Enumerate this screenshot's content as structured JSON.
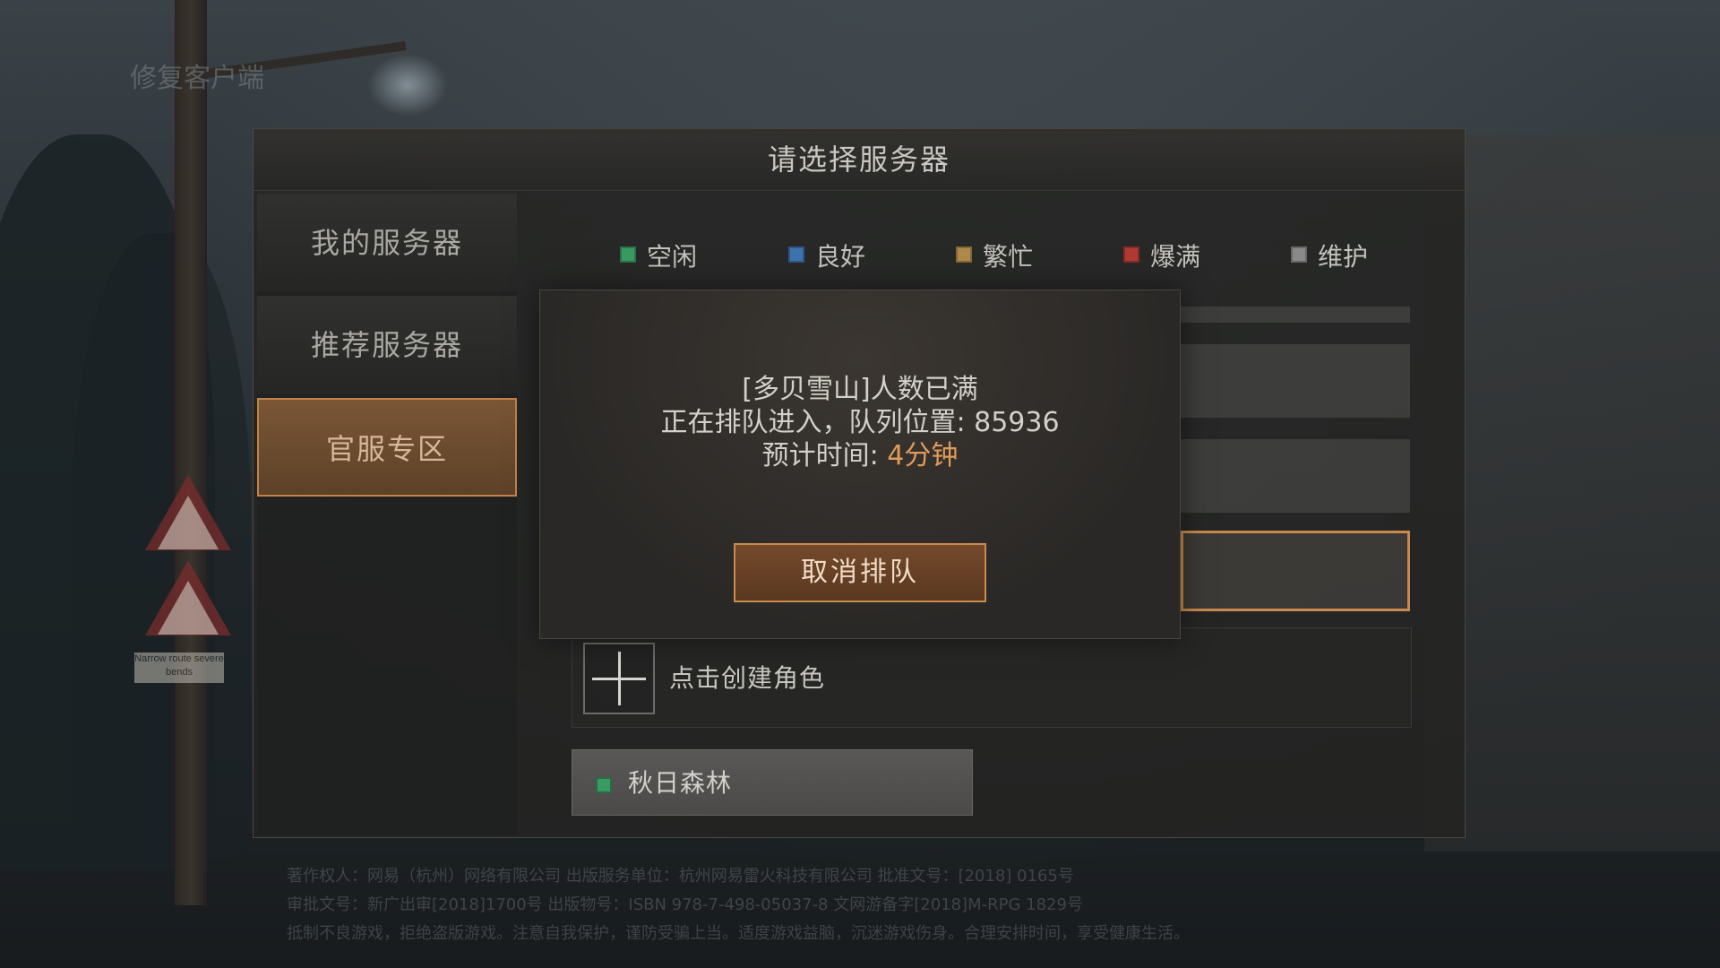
{
  "background": {
    "repair_client": "修复客户端",
    "sign_text": "Narrow route severe bends",
    "footer_lines": [
      "著作权人：网易（杭州）网络有限公司    出版服务单位：杭州网易雷火科技有限公司    批准文号：[2018] 0165号",
      "审批文号：新广出审[2018]1700号    出版物号：ISBN 978-7-498-05037-8    文网游备字[2018]M-RPG 1829号",
      "抵制不良游戏，拒绝盗版游戏。注意自我保护，谨防受骗上当。适度游戏益脑，沉迷游戏伤身。合理安排时间，享受健康生活。"
    ]
  },
  "panel": {
    "title": "请选择服务器",
    "tabs": [
      {
        "label": "我的服务器",
        "active": false
      },
      {
        "label": "推荐服务器",
        "active": false
      },
      {
        "label": "官服专区",
        "active": true
      }
    ],
    "legend": [
      {
        "label": "空闲",
        "color": "#3a9a62"
      },
      {
        "label": "良好",
        "color": "#3f73b0"
      },
      {
        "label": "繁忙",
        "color": "#b08a4a"
      },
      {
        "label": "爆满",
        "color": "#b23a33"
      },
      {
        "label": "维护",
        "color": "#8a8a8a"
      }
    ],
    "create_role": "点击创建角色",
    "server_card": {
      "name": "秋日森林",
      "status_color": "#3a9a62"
    }
  },
  "modal": {
    "line1": "[多贝雪山]人数已满",
    "line2_prefix": "正在排队进入，队列位置: ",
    "queue_position": "85936",
    "line3_prefix": "预计时间: ",
    "eta": "4分钟",
    "cancel_label": "取消排队"
  }
}
